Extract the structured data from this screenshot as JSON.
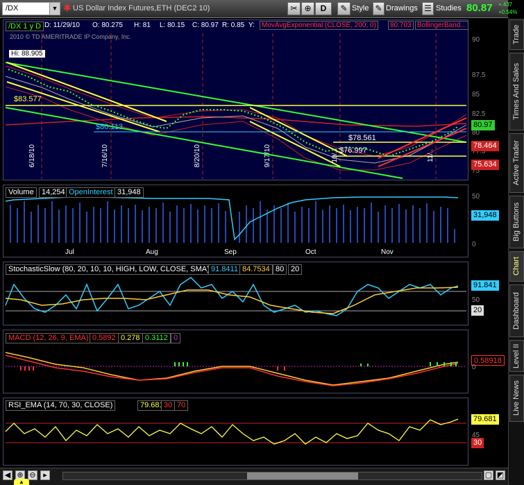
{
  "toolbar": {
    "symbol": "/DX",
    "description": "US Dollar Index Futures,ETH (DEC2 10)",
    "interval": "D",
    "style": "Style",
    "drawings": "Drawings",
    "studies": "Studies",
    "last": "80.87",
    "change1": "+.437",
    "change2": "+0.54%"
  },
  "chart_header": {
    "symbol_period": "/DX 1 y D",
    "date": "D: 11/29/10",
    "open": "O: 80.275",
    "high": "H: 81",
    "low": "L: 80.15",
    "close": "C: 80.97",
    "range": "R: 0.85",
    "y": "Y:",
    "mov_avg": "MovAvgExponential (CLOSE, 200, 0)",
    "mov_avg_val": "80.703",
    "bollinger": "BollingerBand...",
    "copyright": "2010 © TD AMERITRADE IP Company, Inc."
  },
  "price": {
    "hi": "Hi: 88.905",
    "ann1": "$83.577",
    "ann2": "$80.113",
    "ann3": "$78.561",
    "ann4": "$76.997",
    "ticks": [
      "90",
      "87.5",
      "85",
      "82.5",
      "80",
      "77.5",
      "75"
    ],
    "last_badge": "80.97",
    "upper_badge": "78.464",
    "lower_badge": "75.634",
    "dates": [
      "6/18/10",
      "7/16/10",
      "8/20/10",
      "9/17/10",
      "10/..",
      "11/.."
    ]
  },
  "volume": {
    "title": "Volume",
    "volume": "14,254",
    "oi_label": "OpenInterest",
    "oi": "31,948",
    "badge": "31,948",
    "ticks": [
      "50",
      "0"
    ],
    "months": [
      "Jul",
      "Aug",
      "Sep",
      "Oct",
      "Nov"
    ]
  },
  "stoch": {
    "title": "StochasticSlow (80, 20, 10, 10, HIGH, LOW, CLOSE, SMA)",
    "v1": "91.8411",
    "v2": "84.7534",
    "v3": "80",
    "v4": "20",
    "badge": "91.841",
    "badge2": "20",
    "ticks": [
      "50"
    ]
  },
  "macd": {
    "title": "MACD (12, 26, 9, EMA)",
    "v1": "0.5892",
    "v2": "0.278",
    "v3": "0.3112",
    "v4": "0",
    "badge": "0.58918",
    "ticks": [
      "0"
    ]
  },
  "rsi": {
    "title": "RSI_EMA (14, 70, 30, CLOSE)",
    "v1": "79.681",
    "v2": "30",
    "v3": "70",
    "badge": "79.681",
    "badge2": "30",
    "ticks": [
      "45"
    ]
  },
  "sidebar": [
    "Trade",
    "Times And Sales",
    "Active Trader",
    "Big Buttons",
    "Chart",
    "Dashboard",
    "Level II",
    "Live News"
  ],
  "colors": {
    "green": "#33ff33",
    "yellow": "#ffff44",
    "red": "#ff3333",
    "cyan": "#33ddff",
    "bg": "#00003a"
  }
}
